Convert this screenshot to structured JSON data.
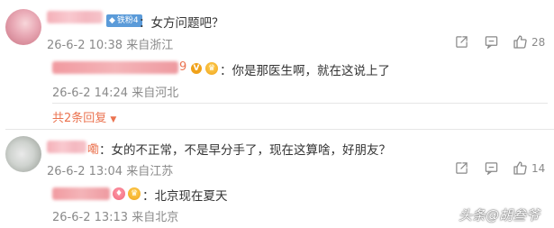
{
  "comments": [
    {
      "badge_label": "铁粉4",
      "text": "：女方问题吧？",
      "meta": "26-6-2 10:38 来自浙江",
      "like_count": "28",
      "replies": [
        {
          "name_suffix": "9",
          "text": "：你是那医生啊，就在这说上了",
          "meta": "26-6-2 14:24 来自河北"
        }
      ],
      "more_replies_label": "共2条回复"
    },
    {
      "name_suffix": "嘞",
      "text": "：女的不正常，不是早分手了，现在这算啥，好朋友？",
      "meta": "26-6-2 13:04 来自江苏",
      "like_count": "14",
      "replies": [
        {
          "text": "：北京现在夏天",
          "meta": "26-6-2 13:13 来自北京"
        }
      ]
    }
  ],
  "watermark": "头条@胡叁爷",
  "colors": {
    "link": "#eb7350",
    "meta": "#8a8a8a",
    "text": "#333333",
    "badge": "#5b9bd9",
    "crown": "#f0a21a"
  },
  "icons": {
    "share": "share-icon",
    "comment": "comment-icon",
    "like": "thumbs-up-icon",
    "expand": "caret-down-icon",
    "crown": "crown-icon",
    "verified": "verified-icon"
  }
}
